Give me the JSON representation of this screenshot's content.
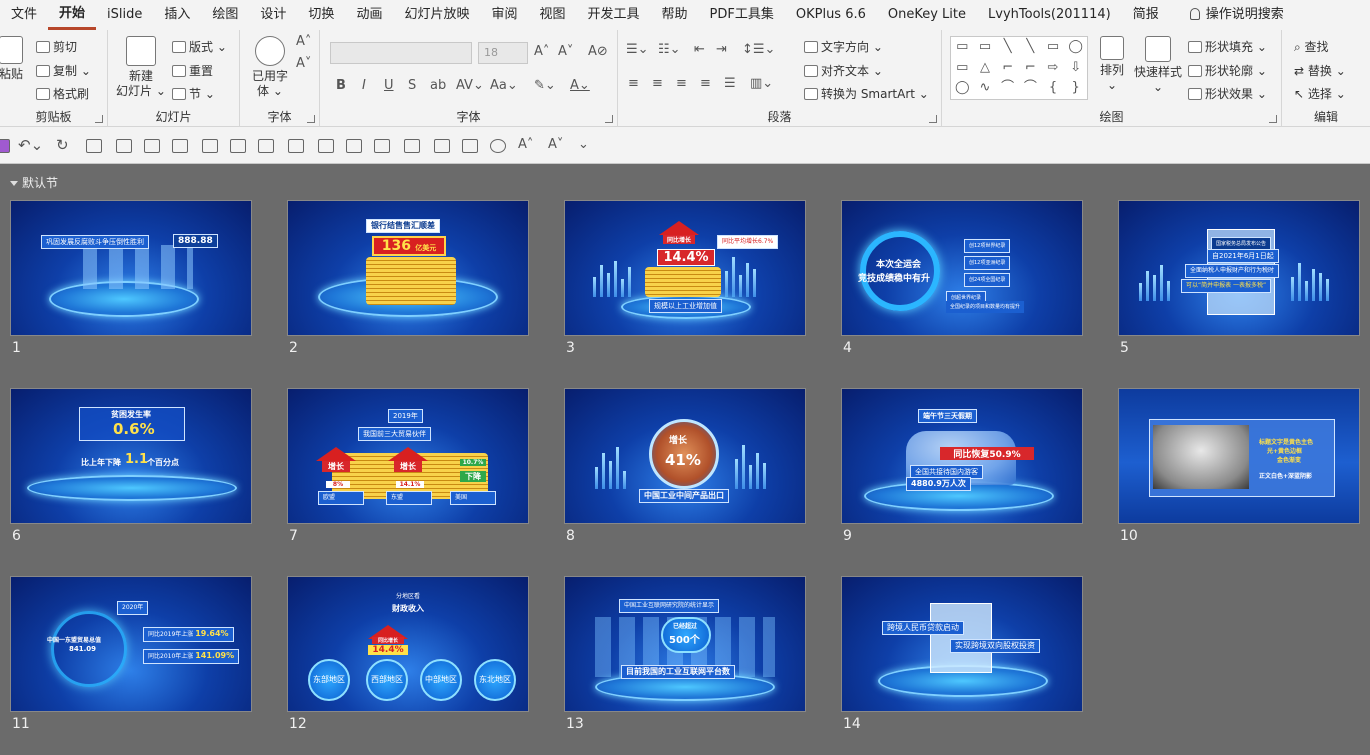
{
  "menu": {
    "tabs": [
      {
        "label": "文件",
        "active": false
      },
      {
        "label": "开始",
        "active": true
      },
      {
        "label": "iSlide",
        "active": false
      },
      {
        "label": "插入",
        "active": false
      },
      {
        "label": "绘图",
        "active": false
      },
      {
        "label": "设计",
        "active": false
      },
      {
        "label": "切换",
        "active": false
      },
      {
        "label": "动画",
        "active": false
      },
      {
        "label": "幻灯片放映",
        "active": false
      },
      {
        "label": "审阅",
        "active": false
      },
      {
        "label": "视图",
        "active": false
      },
      {
        "label": "开发工具",
        "active": false
      },
      {
        "label": "帮助",
        "active": false
      },
      {
        "label": "PDF工具集",
        "active": false
      },
      {
        "label": "OKPlus 6.6",
        "active": false
      },
      {
        "label": "OneKey Lite",
        "active": false
      },
      {
        "label": "LvyhTools(201114)",
        "active": false
      },
      {
        "label": "简报",
        "active": false
      }
    ],
    "tell_me": "操作说明搜索"
  },
  "ribbon": {
    "clipboard": {
      "label": "剪贴板",
      "paste": "粘贴",
      "cut": "剪切",
      "copy": "复制",
      "format_painter": "格式刷"
    },
    "slides": {
      "label": "幻灯片",
      "new_slide": "新建",
      "new_slide2": "幻灯片",
      "layout": "版式",
      "reset": "重置",
      "section": "节"
    },
    "font_group": {
      "label": "字体",
      "font_name": "",
      "font_size": "18",
      "bold": "B",
      "italic": "I",
      "underline": "U",
      "strike": "S",
      "shadow": "ab"
    },
    "charconv": {
      "label": "字体",
      "btn": "已用字",
      "btn2": "体"
    },
    "paragraph": {
      "label": "段落",
      "text_direction": "文字方向",
      "align_text": "对齐文本",
      "smartart": "转换为 SmartArt"
    },
    "drawing": {
      "label": "绘图",
      "arrange": "排列",
      "quick_styles": "快速样式",
      "shape_fill": "形状填充",
      "shape_outline": "形状轮廓",
      "shape_effects": "形状效果"
    },
    "editing": {
      "label": "编辑",
      "find": "查找",
      "replace": "替换",
      "select": "选择"
    }
  },
  "section_title": "默认节",
  "slides": [
    {
      "num": "1",
      "texts": [
        "巩固发展反腐败斗争压倒性胜利",
        "888.88"
      ]
    },
    {
      "num": "2",
      "texts": [
        "银行结售售汇顺差",
        "136",
        "亿美元"
      ]
    },
    {
      "num": "3",
      "texts": [
        "同比增长",
        "14.4%",
        "同比平均增长6.7%",
        "规模以上工业增加值"
      ]
    },
    {
      "num": "4",
      "texts": [
        "本次全运会",
        "竞技成绩稳中有升",
        "创12项世界纪录",
        "创12项亚洲纪录",
        "创24项全国纪录",
        "创超世界纪录",
        "全国纪录的项目和数量均有提升"
      ]
    },
    {
      "num": "5",
      "texts": [
        "国家税务总局发布公告",
        "自2021年6月1日起",
        "全面纳税人申报财产和行为税时",
        "可以“简并申报表 一表报多税”"
      ]
    },
    {
      "num": "6",
      "texts": [
        "贫困发生率",
        "0.6%",
        "比上年下降",
        "1.1",
        "个百分点"
      ]
    },
    {
      "num": "7",
      "texts": [
        "2019年",
        "我国前三大贸易伙伴",
        "增长",
        "增长",
        "8%",
        "14.1%",
        "10.7%",
        "下降",
        "欧盟",
        "东盟",
        "美国"
      ]
    },
    {
      "num": "8",
      "texts": [
        "增长",
        "41%",
        "中国工业中间产品出口"
      ]
    },
    {
      "num": "9",
      "texts": [
        "端午节三天假期",
        "同比恢复50.9%",
        "全国共接待国内游客",
        "4880.9万人次"
      ]
    },
    {
      "num": "10",
      "texts": [
        "标题文字是黄色主色",
        "光+黄色边框",
        "金色渐变",
        "正文白色+深蓝阴影"
      ]
    },
    {
      "num": "11",
      "texts": [
        "2020年",
        "中国一东盟贸易总值",
        "841.09",
        "同比2019年上涨",
        "19.64%",
        "同比2010年上涨",
        "141.09%"
      ]
    },
    {
      "num": "12",
      "texts": [
        "分地区看",
        "财政收入",
        "同比增长",
        "14.4%",
        "东部地区",
        "西部地区",
        "中部地区",
        "东北地区"
      ]
    },
    {
      "num": "13",
      "texts": [
        "中国工业互联网研究院的统计显示",
        "已经超过",
        "500个",
        "目前我国的工业互联网平台数"
      ]
    },
    {
      "num": "14",
      "texts": [
        "跨境人民币贷款启动",
        "实现跨境双向股权投资"
      ]
    }
  ]
}
